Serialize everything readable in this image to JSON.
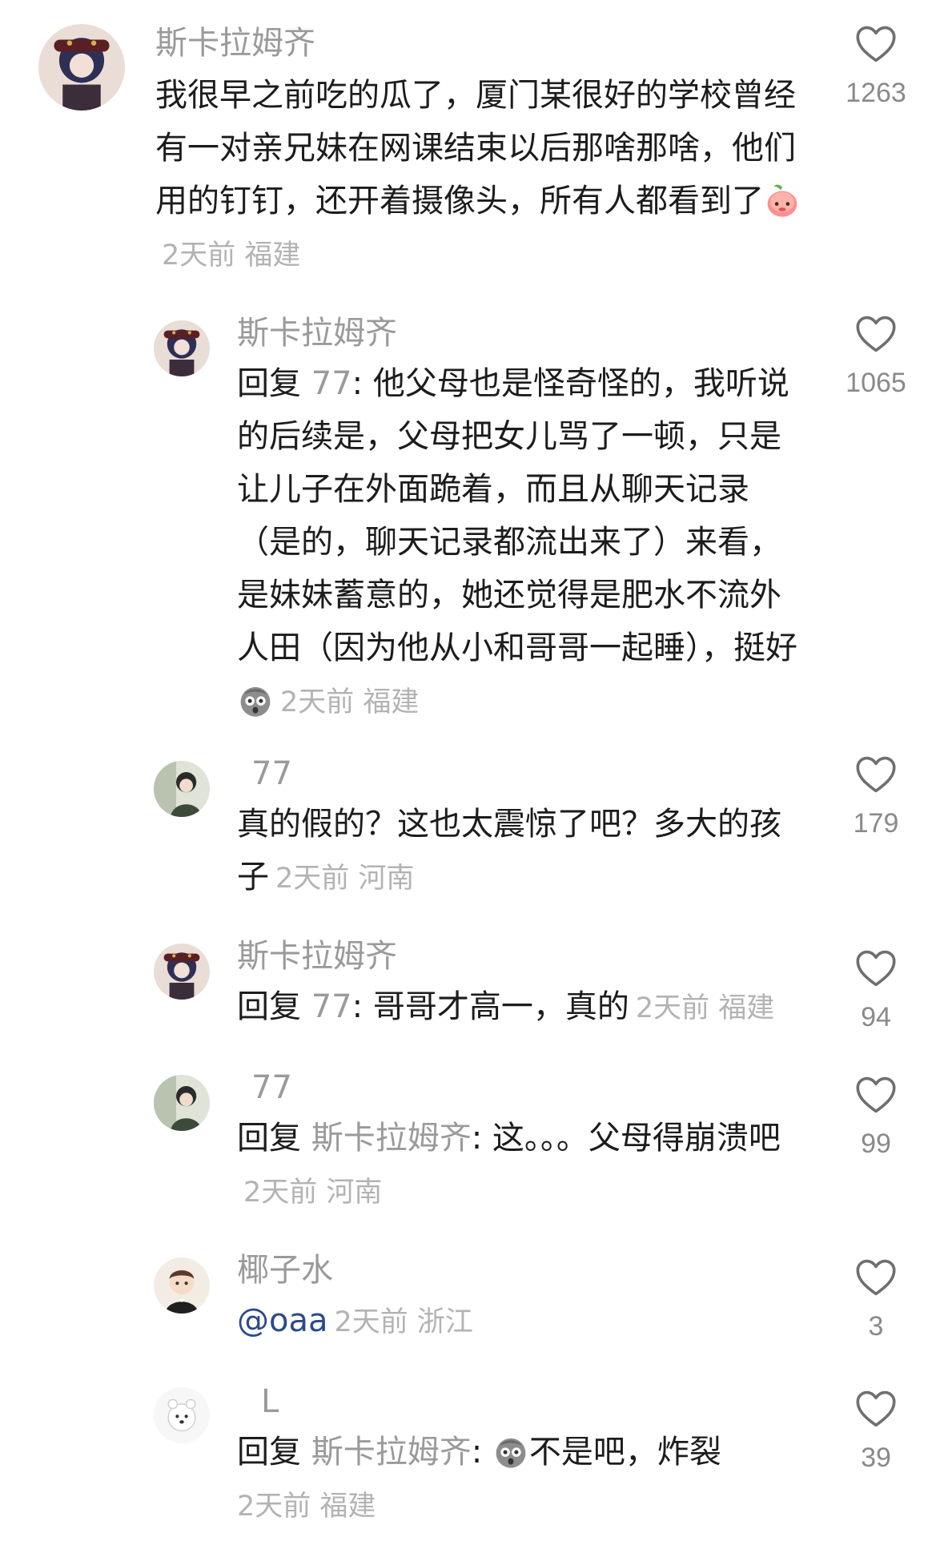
{
  "comments": [
    {
      "username": "斯卡拉姆齐",
      "text": "我很早之前吃的瓜了，厦门某很好的学校曾经有一对亲兄妹在网课结束以后那啥那啥，他们用的钉钉，还开着摄像头，所有人都看到了",
      "emoji": "peach-emoji",
      "meta": "2天前 福建",
      "likes": "1263"
    },
    {
      "username": "斯卡拉姆齐",
      "reply_prefix": "回复 ",
      "reply_target": "77",
      "text": ": 他父母也是怪奇怪的，我听说的后续是，父母把女儿骂了一顿，只是让儿子在外面跪着，而且从聊天记录（是的，聊天记录都流出来了）来看，是妹妹蓄意的，她还觉得是肥水不流外人田（因为他从小和哥哥一起睡），挺好",
      "emoji": "shocked-face-emoji",
      "meta": "2天前 福建",
      "likes": "1065"
    },
    {
      "username": "77",
      "text": "真的假的？这也太震惊了吧？多大的孩子",
      "meta": "2天前 河南",
      "likes": "179"
    },
    {
      "username": "斯卡拉姆齐",
      "reply_prefix": "回复 ",
      "reply_target": "77",
      "text": ": 哥哥才高一，真的",
      "meta": "2天前 福建",
      "likes": "94"
    },
    {
      "username": "77",
      "reply_prefix": "回复 ",
      "reply_target": "斯卡拉姆齐",
      "text": ": 这。。。父母得崩溃吧",
      "meta": "2天前 河南",
      "likes": "99"
    },
    {
      "username": "椰子水",
      "mention": "@oaa",
      "meta": "2天前 浙江",
      "likes": "3"
    },
    {
      "username": "L",
      "reply_prefix": "回复 ",
      "reply_target": "斯卡拉姆齐",
      "text_before_emoji": ": ",
      "emoji": "shocked-face-emoji",
      "text": "不是吧，炸裂",
      "meta": "2天前 福建",
      "likes": "39"
    }
  ],
  "colors": {
    "username": "#9a9a9a",
    "text": "#1c1c1c",
    "meta": "#b3b3b3",
    "mention": "#2b4a8a",
    "heart_stroke": "#6f6f6f"
  },
  "icons": {
    "like": "heart-outline-icon"
  }
}
